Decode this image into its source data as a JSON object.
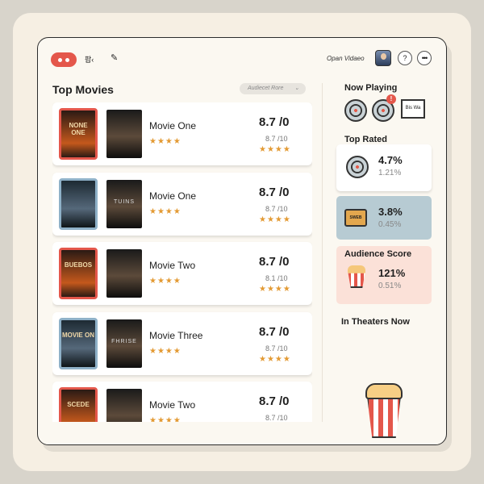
{
  "topbar": {
    "logo_icon": "reel-logo-icon",
    "text": "팝‹",
    "edit_icon": "edit-icon",
    "open_label": "Opan Vidaeo",
    "help_label": "?",
    "more_label": "•••"
  },
  "main": {
    "title": "Top Movies",
    "sort": {
      "label": "Audiecet Rore",
      "chevron": "⌄"
    },
    "movies": [
      {
        "title": "Movie One",
        "poster_text": "NONE ONE",
        "poster2_text": "",
        "score": "8.7 /0",
        "subscore": "8.7 /10",
        "stars": "★★★★",
        "stars_right": "★★★★"
      },
      {
        "title": "Movie One",
        "poster_text": "",
        "poster2_text": "TUINS",
        "score": "8.7 /0",
        "subscore": "8.7 /10",
        "stars": "★★★★",
        "stars_right": "★★★★"
      },
      {
        "title": "Movie Two",
        "poster_text": "BUEBOS",
        "poster2_text": "",
        "score": "8.7 /0",
        "subscore": "8.1 /10",
        "stars": "★★★★",
        "stars_right": "★★★★"
      },
      {
        "title": "Movie Three",
        "poster_text": "MOVIE ON",
        "poster2_text": "FHRISE",
        "score": "8.7 /0",
        "subscore": "8.7 /10",
        "stars": "★★★★",
        "stars_right": "★★★★"
      },
      {
        "title": "Movie Two",
        "poster_text": "SCEDE",
        "poster2_text": "",
        "score": "8.7 /0",
        "subscore": "8.7 /10",
        "stars": "★★★★",
        "stars_right": "★★★★"
      }
    ]
  },
  "sidebar": {
    "now_playing": {
      "title": "Now Playing",
      "badge": "!",
      "clapper_text": "Bis Wa"
    },
    "top_rated": {
      "title": "Top Rated",
      "value": "4.7%",
      "sub": "1.21%",
      "icon": "film-reel-icon"
    },
    "ticket_stat": {
      "value": "3.8%",
      "sub": "0.45%",
      "icon": "ticket-icon",
      "ticket_text": "SWEB"
    },
    "audience": {
      "title": "Audience Score",
      "value": "121%",
      "sub": "0.51%",
      "icon": "popcorn-icon"
    },
    "theaters": {
      "title": "In Theaters Now",
      "icon": "popcorn-bucket-icon"
    }
  }
}
